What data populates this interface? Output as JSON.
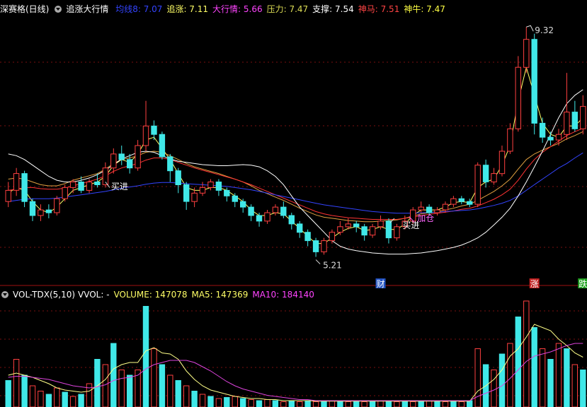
{
  "header": {
    "stock": "深赛格(日线)",
    "indicator": "追涨大行情",
    "values": [
      {
        "label": "均线8",
        "value": "7.07",
        "color": "#3344ff"
      },
      {
        "label": "追涨",
        "value": "7.11",
        "color": "#ffff66"
      },
      {
        "label": "大行情",
        "value": "5.66",
        "color": "#ff44ff"
      },
      {
        "label": "压力",
        "value": "7.47",
        "color": "#dddd55"
      },
      {
        "label": "支撑",
        "value": "7.54",
        "color": "#ffffff"
      },
      {
        "label": "神马",
        "value": "7.51",
        "color": "#ff4444"
      },
      {
        "label": "神牛",
        "value": "7.47",
        "color": "#ffff44"
      }
    ]
  },
  "vol_header": {
    "name": "VOL-TDX(5,10)",
    "vvol": "VVOL: -",
    "volume": "VOLUME: 147078",
    "ma5": "MA5: 147369",
    "ma10": "MA10: 184140"
  },
  "annotations": {
    "high": "9.32",
    "low": "5.21",
    "buy1": "买进",
    "buy2": "买进",
    "add": "加仓",
    "fin": "财",
    "zhang": "涨",
    "die": "跌"
  },
  "chart_data": {
    "type": "candlestick",
    "price_range": [
      4.8,
      9.5
    ],
    "high_mark": 9.32,
    "low_mark": 5.21,
    "candles": [
      [
        6.2,
        6.4,
        6.55,
        6.1
      ],
      [
        6.4,
        6.7,
        6.8,
        6.3
      ],
      [
        6.7,
        6.2,
        6.75,
        6.1
      ],
      [
        6.2,
        5.95,
        6.25,
        5.85
      ],
      [
        5.95,
        6.05,
        6.15,
        5.85
      ],
      [
        6.05,
        6.0,
        6.15,
        5.9
      ],
      [
        6.0,
        6.25,
        6.3,
        5.95
      ],
      [
        6.25,
        6.45,
        6.5,
        6.2
      ],
      [
        6.45,
        6.55,
        6.6,
        6.35
      ],
      [
        6.55,
        6.4,
        6.65,
        6.35
      ],
      [
        6.4,
        6.55,
        6.6,
        6.35
      ],
      [
        6.55,
        6.5,
        6.7,
        6.45
      ],
      [
        6.5,
        6.8,
        6.9,
        6.45
      ],
      [
        6.8,
        7.05,
        7.15,
        6.7
      ],
      [
        7.05,
        6.95,
        7.2,
        6.85
      ],
      [
        6.95,
        6.8,
        7.05,
        6.7
      ],
      [
        6.8,
        7.2,
        7.3,
        6.75
      ],
      [
        7.2,
        7.55,
        8.0,
        7.1
      ],
      [
        7.55,
        7.4,
        7.65,
        7.3
      ],
      [
        7.4,
        7.0,
        7.45,
        6.95
      ],
      [
        7.0,
        6.75,
        7.05,
        6.55
      ],
      [
        6.75,
        6.5,
        6.8,
        6.35
      ],
      [
        6.5,
        6.2,
        6.55,
        6.05
      ],
      [
        6.2,
        6.35,
        6.45,
        6.1
      ],
      [
        6.35,
        6.45,
        6.55,
        6.3
      ],
      [
        6.45,
        6.55,
        6.6,
        6.4
      ],
      [
        6.55,
        6.4,
        6.6,
        6.3
      ],
      [
        6.4,
        6.3,
        6.45,
        6.2
      ],
      [
        6.3,
        6.2,
        6.35,
        6.1
      ],
      [
        6.2,
        6.1,
        6.25,
        6.0
      ],
      [
        6.1,
        5.95,
        6.15,
        5.85
      ],
      [
        5.95,
        5.85,
        6.0,
        5.75
      ],
      [
        5.85,
        6.0,
        6.05,
        5.8
      ],
      [
        6.0,
        6.1,
        6.15,
        5.95
      ],
      [
        6.1,
        5.95,
        6.2,
        5.9
      ],
      [
        5.95,
        5.8,
        6.0,
        5.7
      ],
      [
        5.8,
        5.65,
        5.85,
        5.55
      ],
      [
        5.65,
        5.5,
        5.7,
        5.4
      ],
      [
        5.5,
        5.3,
        5.55,
        5.21
      ],
      [
        5.3,
        5.5,
        5.55,
        5.25
      ],
      [
        5.5,
        5.65,
        5.7,
        5.45
      ],
      [
        5.65,
        5.75,
        5.85,
        5.6
      ],
      [
        5.75,
        5.8,
        5.9,
        5.7
      ],
      [
        5.8,
        5.75,
        5.85,
        5.65
      ],
      [
        5.75,
        5.6,
        5.8,
        5.5
      ],
      [
        5.6,
        5.75,
        5.8,
        5.55
      ],
      [
        5.75,
        5.85,
        5.95,
        5.7
      ],
      [
        5.85,
        5.55,
        5.9,
        5.45
      ],
      [
        5.55,
        5.75,
        5.8,
        5.5
      ],
      [
        5.75,
        5.85,
        5.95,
        5.7
      ],
      [
        5.85,
        6.05,
        6.1,
        5.8
      ],
      [
        6.05,
        6.1,
        6.2,
        6.0
      ],
      [
        6.1,
        6.0,
        6.15,
        5.95
      ],
      [
        6.0,
        6.05,
        6.1,
        5.95
      ],
      [
        6.05,
        6.15,
        6.2,
        6.0
      ],
      [
        6.15,
        6.25,
        6.3,
        6.1
      ],
      [
        6.25,
        6.2,
        6.3,
        6.15
      ],
      [
        6.2,
        6.15,
        6.25,
        6.1
      ],
      [
        6.15,
        6.85,
        6.9,
        6.1
      ],
      [
        6.85,
        6.55,
        6.95,
        6.45
      ],
      [
        6.55,
        6.7,
        6.8,
        6.5
      ],
      [
        6.7,
        7.1,
        7.2,
        6.65
      ],
      [
        7.1,
        7.5,
        7.6,
        7.05
      ],
      [
        7.5,
        8.6,
        8.8,
        7.45
      ],
      [
        8.6,
        9.1,
        9.32,
        8.5
      ],
      [
        9.1,
        7.6,
        9.2,
        7.4
      ],
      [
        7.6,
        7.35,
        7.7,
        7.25
      ],
      [
        7.35,
        7.3,
        7.45,
        7.2
      ],
      [
        7.3,
        7.4,
        7.5,
        7.2
      ],
      [
        7.4,
        7.8,
        8.5,
        7.3
      ],
      [
        7.8,
        7.5,
        8.0,
        7.45
      ],
      [
        7.5,
        7.9,
        8.1,
        7.4
      ]
    ],
    "lines": [
      {
        "name": "追涨",
        "color": "#ffff66",
        "values": [
          6.35,
          6.45,
          6.4,
          6.2,
          6.05,
          6.0,
          6.1,
          6.25,
          6.4,
          6.45,
          6.5,
          6.55,
          6.65,
          6.85,
          6.95,
          6.9,
          7.05,
          7.3,
          7.35,
          7.15,
          6.95,
          6.7,
          6.45,
          6.4,
          6.4,
          6.45,
          6.45,
          6.4,
          6.3,
          6.2,
          6.05,
          5.95,
          5.95,
          6.0,
          5.98,
          5.85,
          5.72,
          5.58,
          5.45,
          5.45,
          5.55,
          5.65,
          5.72,
          5.75,
          5.68,
          5.7,
          5.75,
          5.7,
          5.7,
          5.8,
          5.95,
          6.05,
          6.05,
          6.05,
          6.1,
          6.18,
          6.2,
          6.18,
          6.45,
          6.55,
          6.6,
          6.85,
          7.2,
          8.0,
          8.6,
          8.1,
          7.6,
          7.4,
          7.35,
          7.55,
          7.55,
          7.7
        ]
      },
      {
        "name": "压力",
        "color": "#e0a040",
        "values": [
          6.6,
          6.62,
          6.6,
          6.55,
          6.5,
          6.48,
          6.48,
          6.52,
          6.58,
          6.62,
          6.66,
          6.7,
          6.78,
          6.88,
          6.95,
          6.98,
          7.02,
          7.08,
          7.1,
          7.08,
          7.02,
          6.95,
          6.88,
          6.82,
          6.78,
          6.74,
          6.7,
          6.65,
          6.6,
          6.55,
          6.48,
          6.4,
          6.34,
          6.28,
          6.22,
          6.15,
          6.08,
          6.02,
          5.96,
          5.92,
          5.9,
          5.88,
          5.86,
          5.85,
          5.84,
          5.84,
          5.85,
          5.86,
          5.87,
          5.9,
          5.94,
          5.98,
          6.0,
          6.02,
          6.05,
          6.08,
          6.12,
          6.15,
          6.22,
          6.3,
          6.38,
          6.48,
          6.6,
          6.78,
          6.95,
          7.05,
          7.12,
          7.18,
          7.24,
          7.32,
          7.38,
          7.45
        ]
      },
      {
        "name": "神马",
        "color": "#ff3333",
        "values": [
          6.4,
          6.42,
          6.45,
          6.45,
          6.43,
          6.42,
          6.42,
          6.44,
          6.48,
          6.52,
          6.56,
          6.6,
          6.66,
          6.74,
          6.8,
          6.84,
          6.88,
          6.94,
          6.98,
          6.98,
          6.95,
          6.9,
          6.85,
          6.8,
          6.76,
          6.72,
          6.68,
          6.64,
          6.6,
          6.55,
          6.5,
          6.44,
          6.38,
          6.32,
          6.26,
          6.2,
          6.14,
          6.08,
          6.02,
          5.98,
          5.95,
          5.93,
          5.91,
          5.9,
          5.89,
          5.88,
          5.88,
          5.88,
          5.88,
          5.9,
          5.92,
          5.95,
          5.97,
          5.99,
          6.01,
          6.03,
          6.06,
          6.08,
          6.12,
          6.18,
          6.24,
          6.32,
          6.42,
          6.58,
          6.78,
          6.95,
          7.08,
          7.18,
          7.28,
          7.38,
          7.45,
          7.51
        ]
      },
      {
        "name": "均线8",
        "color": "#3344ff",
        "values": [
          6.2,
          6.22,
          6.24,
          6.25,
          6.25,
          6.25,
          6.26,
          6.28,
          6.3,
          6.32,
          6.34,
          6.36,
          6.38,
          6.41,
          6.44,
          6.46,
          6.48,
          6.51,
          6.53,
          6.54,
          6.54,
          6.53,
          6.52,
          6.51,
          6.5,
          6.49,
          6.48,
          6.47,
          6.45,
          6.43,
          6.41,
          6.38,
          6.35,
          6.32,
          6.29,
          6.26,
          6.23,
          6.2,
          6.17,
          6.14,
          6.12,
          6.1,
          6.08,
          6.06,
          6.04,
          6.02,
          6.01,
          6.0,
          5.99,
          5.99,
          5.99,
          6.0,
          6.0,
          6.01,
          6.02,
          6.03,
          6.04,
          6.05,
          6.07,
          6.1,
          6.13,
          6.17,
          6.22,
          6.3,
          6.4,
          6.5,
          6.6,
          6.7,
          6.8,
          6.88,
          6.98,
          7.07
        ]
      },
      {
        "name": "支撑",
        "color": "#ffffff",
        "values": [
          7.05,
          7.02,
          6.95,
          6.85,
          6.75,
          6.65,
          6.58,
          6.55,
          6.55,
          6.58,
          6.62,
          6.68,
          6.76,
          6.86,
          6.96,
          7.02,
          7.08,
          7.1,
          7.08,
          7.02,
          6.96,
          6.92,
          6.9,
          6.88,
          6.86,
          6.85,
          6.84,
          6.84,
          6.85,
          6.86,
          6.85,
          6.82,
          6.75,
          6.65,
          6.5,
          6.3,
          6.1,
          5.95,
          5.8,
          5.65,
          5.5,
          5.4,
          5.35,
          5.32,
          5.3,
          5.28,
          5.27,
          5.26,
          5.26,
          5.26,
          5.27,
          5.28,
          5.3,
          5.32,
          5.35,
          5.38,
          5.42,
          5.48,
          5.55,
          5.65,
          5.78,
          5.92,
          6.08,
          6.3,
          6.55,
          6.82,
          7.1,
          7.4,
          7.7,
          7.95,
          8.1,
          8.2
        ]
      }
    ],
    "volume": [
      [
        0.25,
        true
      ],
      [
        0.45,
        false
      ],
      [
        0.3,
        true
      ],
      [
        0.2,
        false
      ],
      [
        0.15,
        false
      ],
      [
        0.12,
        true
      ],
      [
        0.18,
        false
      ],
      [
        0.14,
        true
      ],
      [
        0.1,
        false
      ],
      [
        0.12,
        true
      ],
      [
        0.22,
        false
      ],
      [
        0.45,
        true
      ],
      [
        0.4,
        false
      ],
      [
        0.6,
        true
      ],
      [
        0.35,
        false
      ],
      [
        0.3,
        true
      ],
      [
        0.35,
        false
      ],
      [
        0.95,
        true
      ],
      [
        0.55,
        false
      ],
      [
        0.4,
        true
      ],
      [
        0.3,
        false
      ],
      [
        0.25,
        true
      ],
      [
        0.2,
        false
      ],
      [
        0.15,
        true
      ],
      [
        0.12,
        false
      ],
      [
        0.1,
        true
      ],
      [
        0.08,
        false
      ],
      [
        0.09,
        true
      ],
      [
        0.1,
        false
      ],
      [
        0.08,
        true
      ],
      [
        0.07,
        false
      ],
      [
        0.06,
        true
      ],
      [
        0.07,
        false
      ],
      [
        0.06,
        true
      ],
      [
        0.05,
        false
      ],
      [
        0.06,
        true
      ],
      [
        0.05,
        false
      ],
      [
        0.06,
        true
      ],
      [
        0.05,
        false
      ],
      [
        0.05,
        true
      ],
      [
        0.06,
        false
      ],
      [
        0.05,
        true
      ],
      [
        0.05,
        false
      ],
      [
        0.06,
        true
      ],
      [
        0.05,
        false
      ],
      [
        0.05,
        true
      ],
      [
        0.06,
        false
      ],
      [
        0.05,
        true
      ],
      [
        0.05,
        false
      ],
      [
        0.06,
        true
      ],
      [
        0.05,
        false
      ],
      [
        0.05,
        true
      ],
      [
        0.06,
        false
      ],
      [
        0.05,
        true
      ],
      [
        0.05,
        false
      ],
      [
        0.06,
        true
      ],
      [
        0.05,
        false
      ],
      [
        0.06,
        true
      ],
      [
        0.55,
        false
      ],
      [
        0.4,
        true
      ],
      [
        0.35,
        false
      ],
      [
        0.5,
        true
      ],
      [
        0.6,
        false
      ],
      [
        0.85,
        true
      ],
      [
        1.0,
        false
      ],
      [
        0.75,
        true
      ],
      [
        0.55,
        false
      ],
      [
        0.45,
        true
      ],
      [
        0.6,
        false
      ],
      [
        0.55,
        true
      ],
      [
        0.4,
        false
      ],
      [
        0.35,
        true
      ]
    ],
    "volume_ma": [
      {
        "name": "MA5",
        "color": "#ffff88",
        "values": [
          0.3,
          0.32,
          0.3,
          0.28,
          0.25,
          0.22,
          0.18,
          0.16,
          0.15,
          0.14,
          0.15,
          0.2,
          0.26,
          0.36,
          0.4,
          0.42,
          0.42,
          0.53,
          0.56,
          0.51,
          0.5,
          0.45,
          0.34,
          0.26,
          0.2,
          0.16,
          0.14,
          0.12,
          0.1,
          0.09,
          0.08,
          0.08,
          0.07,
          0.07,
          0.06,
          0.06,
          0.06,
          0.06,
          0.055,
          0.055,
          0.055,
          0.055,
          0.055,
          0.055,
          0.055,
          0.055,
          0.055,
          0.055,
          0.055,
          0.055,
          0.055,
          0.055,
          0.055,
          0.055,
          0.055,
          0.055,
          0.055,
          0.055,
          0.15,
          0.2,
          0.26,
          0.35,
          0.48,
          0.55,
          0.66,
          0.78,
          0.75,
          0.72,
          0.64,
          0.58,
          0.51,
          0.47
        ]
      },
      {
        "name": "MA10",
        "color": "#dd44dd",
        "values": [
          0.28,
          0.29,
          0.29,
          0.28,
          0.27,
          0.26,
          0.24,
          0.22,
          0.2,
          0.19,
          0.18,
          0.19,
          0.21,
          0.25,
          0.27,
          0.28,
          0.3,
          0.36,
          0.4,
          0.42,
          0.44,
          0.44,
          0.44,
          0.42,
          0.38,
          0.34,
          0.29,
          0.24,
          0.2,
          0.17,
          0.15,
          0.13,
          0.11,
          0.1,
          0.09,
          0.08,
          0.07,
          0.07,
          0.06,
          0.06,
          0.06,
          0.06,
          0.06,
          0.06,
          0.06,
          0.06,
          0.06,
          0.06,
          0.06,
          0.06,
          0.06,
          0.06,
          0.06,
          0.06,
          0.06,
          0.06,
          0.06,
          0.06,
          0.1,
          0.13,
          0.16,
          0.2,
          0.27,
          0.35,
          0.43,
          0.48,
          0.5,
          0.52,
          0.55,
          0.58,
          0.6,
          0.6
        ]
      }
    ]
  }
}
